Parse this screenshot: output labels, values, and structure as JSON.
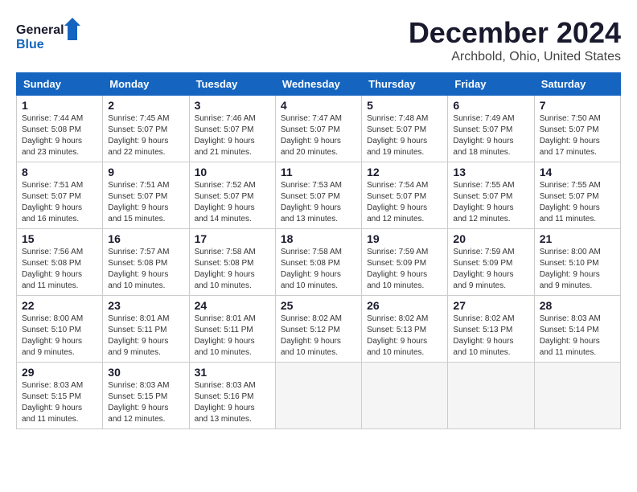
{
  "header": {
    "logo_line1": "General",
    "logo_line2": "Blue",
    "title": "December 2024",
    "subtitle": "Archbold, Ohio, United States"
  },
  "days_of_week": [
    "Sunday",
    "Monday",
    "Tuesday",
    "Wednesday",
    "Thursday",
    "Friday",
    "Saturday"
  ],
  "weeks": [
    [
      {
        "day": "1",
        "info": "Sunrise: 7:44 AM\nSunset: 5:08 PM\nDaylight: 9 hours\nand 23 minutes."
      },
      {
        "day": "2",
        "info": "Sunrise: 7:45 AM\nSunset: 5:07 PM\nDaylight: 9 hours\nand 22 minutes."
      },
      {
        "day": "3",
        "info": "Sunrise: 7:46 AM\nSunset: 5:07 PM\nDaylight: 9 hours\nand 21 minutes."
      },
      {
        "day": "4",
        "info": "Sunrise: 7:47 AM\nSunset: 5:07 PM\nDaylight: 9 hours\nand 20 minutes."
      },
      {
        "day": "5",
        "info": "Sunrise: 7:48 AM\nSunset: 5:07 PM\nDaylight: 9 hours\nand 19 minutes."
      },
      {
        "day": "6",
        "info": "Sunrise: 7:49 AM\nSunset: 5:07 PM\nDaylight: 9 hours\nand 18 minutes."
      },
      {
        "day": "7",
        "info": "Sunrise: 7:50 AM\nSunset: 5:07 PM\nDaylight: 9 hours\nand 17 minutes."
      }
    ],
    [
      {
        "day": "8",
        "info": "Sunrise: 7:51 AM\nSunset: 5:07 PM\nDaylight: 9 hours\nand 16 minutes."
      },
      {
        "day": "9",
        "info": "Sunrise: 7:51 AM\nSunset: 5:07 PM\nDaylight: 9 hours\nand 15 minutes."
      },
      {
        "day": "10",
        "info": "Sunrise: 7:52 AM\nSunset: 5:07 PM\nDaylight: 9 hours\nand 14 minutes."
      },
      {
        "day": "11",
        "info": "Sunrise: 7:53 AM\nSunset: 5:07 PM\nDaylight: 9 hours\nand 13 minutes."
      },
      {
        "day": "12",
        "info": "Sunrise: 7:54 AM\nSunset: 5:07 PM\nDaylight: 9 hours\nand 12 minutes."
      },
      {
        "day": "13",
        "info": "Sunrise: 7:55 AM\nSunset: 5:07 PM\nDaylight: 9 hours\nand 12 minutes."
      },
      {
        "day": "14",
        "info": "Sunrise: 7:55 AM\nSunset: 5:07 PM\nDaylight: 9 hours\nand 11 minutes."
      }
    ],
    [
      {
        "day": "15",
        "info": "Sunrise: 7:56 AM\nSunset: 5:08 PM\nDaylight: 9 hours\nand 11 minutes."
      },
      {
        "day": "16",
        "info": "Sunrise: 7:57 AM\nSunset: 5:08 PM\nDaylight: 9 hours\nand 10 minutes."
      },
      {
        "day": "17",
        "info": "Sunrise: 7:58 AM\nSunset: 5:08 PM\nDaylight: 9 hours\nand 10 minutes."
      },
      {
        "day": "18",
        "info": "Sunrise: 7:58 AM\nSunset: 5:08 PM\nDaylight: 9 hours\nand 10 minutes."
      },
      {
        "day": "19",
        "info": "Sunrise: 7:59 AM\nSunset: 5:09 PM\nDaylight: 9 hours\nand 10 minutes."
      },
      {
        "day": "20",
        "info": "Sunrise: 7:59 AM\nSunset: 5:09 PM\nDaylight: 9 hours\nand 9 minutes."
      },
      {
        "day": "21",
        "info": "Sunrise: 8:00 AM\nSunset: 5:10 PM\nDaylight: 9 hours\nand 9 minutes."
      }
    ],
    [
      {
        "day": "22",
        "info": "Sunrise: 8:00 AM\nSunset: 5:10 PM\nDaylight: 9 hours\nand 9 minutes."
      },
      {
        "day": "23",
        "info": "Sunrise: 8:01 AM\nSunset: 5:11 PM\nDaylight: 9 hours\nand 9 minutes."
      },
      {
        "day": "24",
        "info": "Sunrise: 8:01 AM\nSunset: 5:11 PM\nDaylight: 9 hours\nand 10 minutes."
      },
      {
        "day": "25",
        "info": "Sunrise: 8:02 AM\nSunset: 5:12 PM\nDaylight: 9 hours\nand 10 minutes."
      },
      {
        "day": "26",
        "info": "Sunrise: 8:02 AM\nSunset: 5:13 PM\nDaylight: 9 hours\nand 10 minutes."
      },
      {
        "day": "27",
        "info": "Sunrise: 8:02 AM\nSunset: 5:13 PM\nDaylight: 9 hours\nand 10 minutes."
      },
      {
        "day": "28",
        "info": "Sunrise: 8:03 AM\nSunset: 5:14 PM\nDaylight: 9 hours\nand 11 minutes."
      }
    ],
    [
      {
        "day": "29",
        "info": "Sunrise: 8:03 AM\nSunset: 5:15 PM\nDaylight: 9 hours\nand 11 minutes."
      },
      {
        "day": "30",
        "info": "Sunrise: 8:03 AM\nSunset: 5:15 PM\nDaylight: 9 hours\nand 12 minutes."
      },
      {
        "day": "31",
        "info": "Sunrise: 8:03 AM\nSunset: 5:16 PM\nDaylight: 9 hours\nand 13 minutes."
      },
      {
        "day": "",
        "info": ""
      },
      {
        "day": "",
        "info": ""
      },
      {
        "day": "",
        "info": ""
      },
      {
        "day": "",
        "info": ""
      }
    ]
  ]
}
